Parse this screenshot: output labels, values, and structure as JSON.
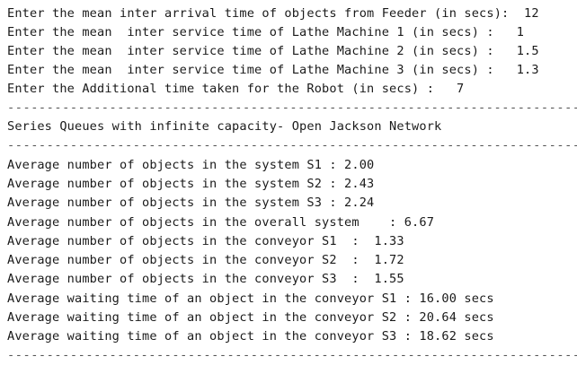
{
  "console": {
    "input_lines": [
      "Enter the mean inter arrival time of objects from Feeder (in secs):  12",
      "Enter the mean  inter service time of Lathe Machine 1 (in secs) :   1",
      "Enter the mean  inter service time of Lathe Machine 2 (in secs) :   1.5",
      "Enter the mean  inter service time of Lathe Machine 3 (in secs) :   1.3",
      "Enter the Additional time taken for the Robot (in secs) :   7"
    ],
    "separator": "---------------------------------------------------------------------------------------",
    "heading": "Series Queues with infinite capacity- Open Jackson Network",
    "result_lines": [
      "Average number of objects in the system S1 : 2.00",
      "Average number of objects in the system S2 : 2.43",
      "Average number of objects in the system S3 : 2.24",
      "Average number of objects in the overall system    : 6.67",
      "Average number of objects in the conveyor S1  :  1.33",
      "Average number of objects in the conveyor S2  :  1.72",
      "Average number of objects in the conveyor S3  :  1.55",
      "Average waiting time of an object in the conveyor S1 : 16.00 secs",
      "Average waiting time of an object in the conveyor S2 : 20.64 secs",
      "Average waiting time of an object in the conveyor S3 : 18.62 secs"
    ]
  }
}
